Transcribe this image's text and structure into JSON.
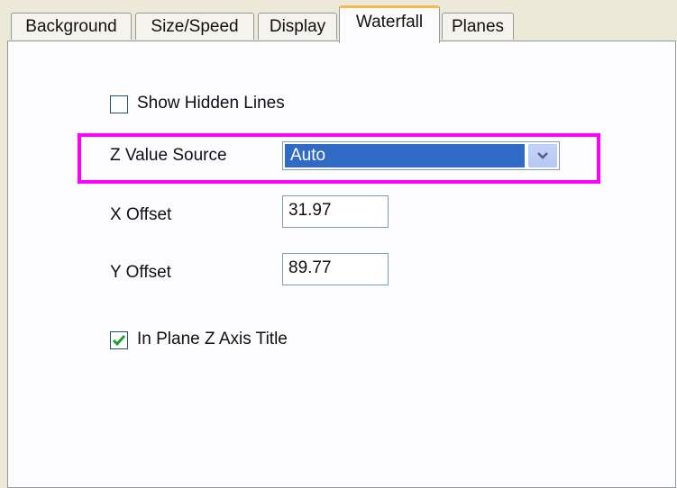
{
  "tabs": [
    {
      "label": "Background",
      "active": false
    },
    {
      "label": "Size/Speed",
      "active": false
    },
    {
      "label": "Display",
      "active": false
    },
    {
      "label": "Waterfall",
      "active": true
    },
    {
      "label": "Planes",
      "active": false
    }
  ],
  "show_hidden_lines": {
    "label": "Show Hidden Lines",
    "checked": false
  },
  "z_value_source": {
    "label": "Z Value Source",
    "value": "Auto"
  },
  "x_offset": {
    "label": "X Offset",
    "value": "31.97"
  },
  "y_offset": {
    "label": "Y Offset",
    "value": "89.77"
  },
  "in_plane_z_axis_title": {
    "label": "In Plane Z Axis Title",
    "checked": true
  },
  "colors": {
    "highlight": "#ff00ff",
    "selection": "#316ac5",
    "active_tab_accent": "#f9b84a"
  }
}
